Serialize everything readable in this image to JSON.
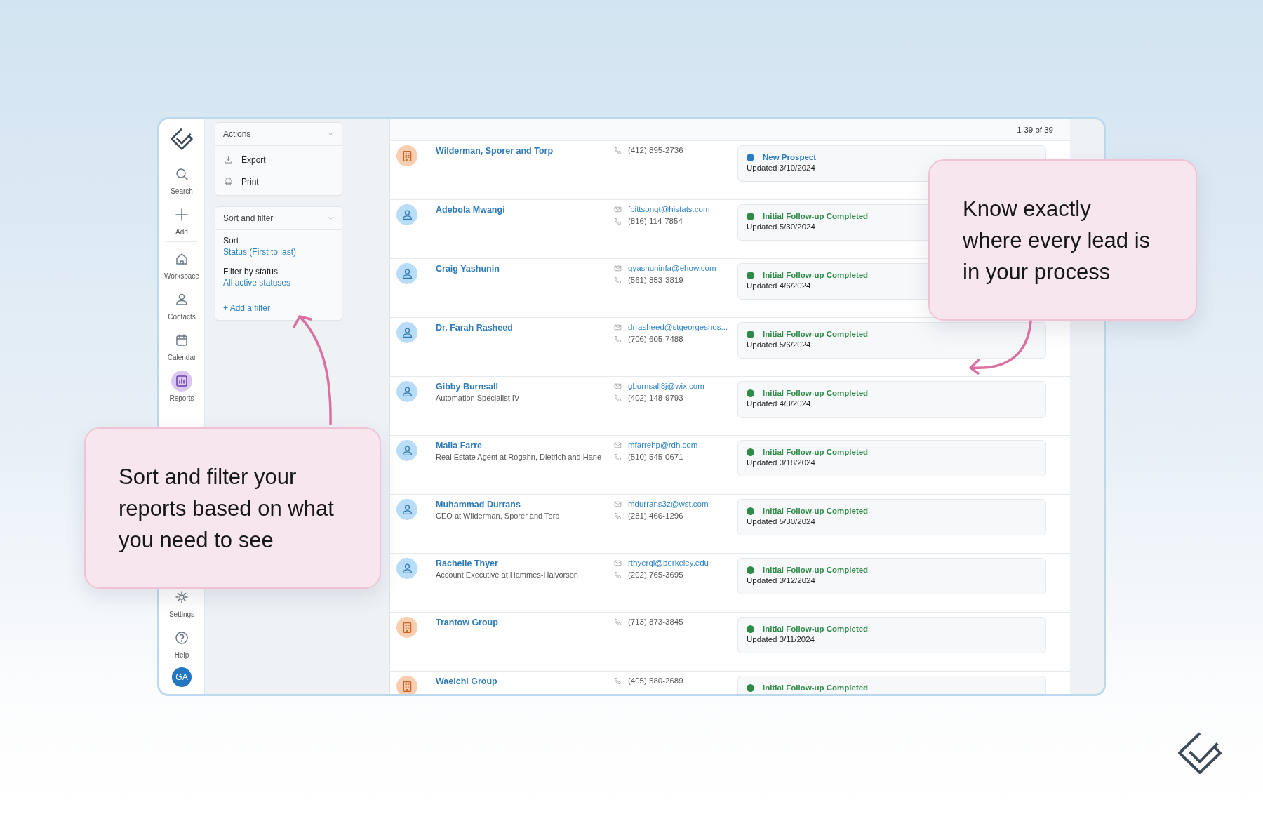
{
  "sidebar": {
    "items": [
      {
        "label": "Search",
        "selected": false
      },
      {
        "label": "Add",
        "selected": false
      },
      {
        "label": "Workspace",
        "selected": false
      },
      {
        "label": "Contacts",
        "selected": false
      },
      {
        "label": "Calendar",
        "selected": false
      },
      {
        "label": "Reports",
        "selected": true
      }
    ],
    "bottom_items": [
      {
        "label": "Settings"
      },
      {
        "label": "Help"
      }
    ],
    "avatar": "GA"
  },
  "actions": {
    "title": "Actions",
    "items": [
      {
        "label": "Export"
      },
      {
        "label": "Print"
      }
    ]
  },
  "sort_filter": {
    "title": "Sort and filter",
    "fields": [
      {
        "label": "Sort",
        "value": "Status (First to last)"
      },
      {
        "label": "Filter by status",
        "value": "All active statuses"
      }
    ],
    "add_filter": "+ Add a filter"
  },
  "list": {
    "count": "1-39 of 39",
    "rows": [
      {
        "kind": "company",
        "name": "Wilderman, Sporer and Torp",
        "phone": "(412) 895-2736",
        "status": {
          "label": "New Prospect",
          "color": "#2b7bc0",
          "updated": "Updated 3/10/2024"
        }
      },
      {
        "kind": "person",
        "name": "Adebola Mwangi",
        "email": "fpittsonqt@histats.com",
        "phone": "(816) 114-7854",
        "status": {
          "label": "Initial Follow-up Completed",
          "color": "#2e8b47",
          "updated": "Updated 5/30/2024"
        }
      },
      {
        "kind": "person",
        "name": "Craig Yashunin",
        "email": "gyashuninfa@ehow.com",
        "phone": "(561) 853-3819",
        "status": {
          "label": "Initial Follow-up Completed",
          "color": "#2e8b47",
          "updated": "Updated 4/6/2024"
        }
      },
      {
        "kind": "person",
        "name": "Dr. Farah Rasheed",
        "email": "drrasheed@stgeorgeshos...",
        "phone": "(706) 605-7488",
        "status": {
          "label": "Initial Follow-up Completed",
          "color": "#2e8b47",
          "updated": "Updated 5/6/2024"
        }
      },
      {
        "kind": "person",
        "name": "Gibby Burnsall",
        "subtitle": "Automation Specialist IV",
        "email": "gburnsall8j@wix.com",
        "phone": "(402) 148-9793",
        "status": {
          "label": "Initial Follow-up Completed",
          "color": "#2e8b47",
          "updated": "Updated 4/3/2024"
        }
      },
      {
        "kind": "person",
        "name": "Malia Farre",
        "subtitle": "Real Estate Agent at Rogahn, Dietrich and Hane",
        "email": "mfarrehp@rdh.com",
        "phone": "(510) 545-0671",
        "status": {
          "label": "Initial Follow-up Completed",
          "color": "#2e8b47",
          "updated": "Updated 3/18/2024"
        }
      },
      {
        "kind": "person",
        "name": "Muhammad Durrans",
        "subtitle": "CEO at Wilderman, Sporer and Torp",
        "email": "mdurrans3z@wst.com",
        "phone": "(281) 466-1296",
        "status": {
          "label": "Initial Follow-up Completed",
          "color": "#2e8b47",
          "updated": "Updated 5/30/2024"
        }
      },
      {
        "kind": "person",
        "name": "Rachelle Thyer",
        "subtitle": "Account Executive at Hammes-Halvorson",
        "email": "rthyerqi@berkeley.edu",
        "phone": "(202) 765-3695",
        "status": {
          "label": "Initial Follow-up Completed",
          "color": "#2e8b47",
          "updated": "Updated 3/12/2024"
        }
      },
      {
        "kind": "company",
        "name": "Trantow Group",
        "phone": "(713) 873-3845",
        "status": {
          "label": "Initial Follow-up Completed",
          "color": "#2e8b47",
          "updated": "Updated 3/11/2024"
        }
      },
      {
        "kind": "company",
        "name": "Waelchi Group",
        "phone": "(405) 580-2689",
        "status": {
          "label": "Initial Follow-up Completed",
          "color": "#2e8b47"
        }
      }
    ]
  },
  "callouts": [
    {
      "text": "Sort and filter your\nreports based on what\nyou need to see"
    },
    {
      "text": "Know exactly\nwhere every lead is\nin your process"
    }
  ]
}
